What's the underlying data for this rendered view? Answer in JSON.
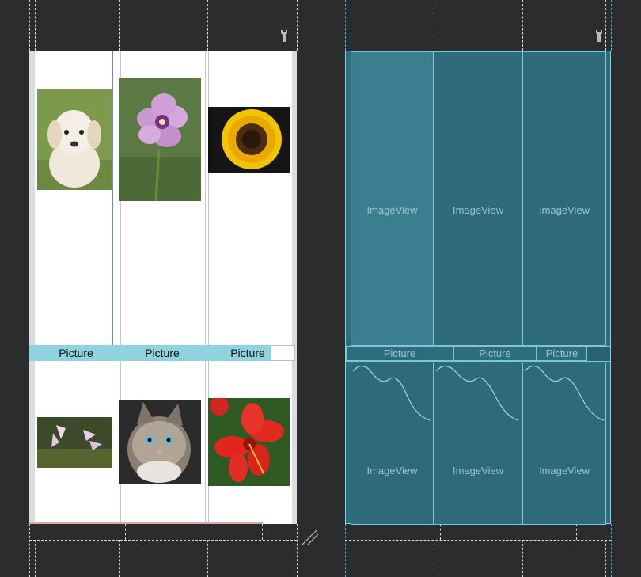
{
  "design": {
    "top_row": [
      {
        "icon": "puppy-photo",
        "label": "Picture"
      },
      {
        "icon": "flower-photo",
        "label": "Picture"
      },
      {
        "icon": "sunflower-photo",
        "label": "Picture"
      }
    ],
    "bottom_row": [
      {
        "icon": "lily-photo"
      },
      {
        "icon": "cat-photo"
      },
      {
        "icon": "hibiscus-photo"
      }
    ]
  },
  "blueprint": {
    "top_row": [
      {
        "label": "ImageView"
      },
      {
        "label": "ImageView"
      },
      {
        "label": "ImageView"
      }
    ],
    "pictures": [
      "Picture",
      "Picture",
      "Picture"
    ],
    "bottom_row": [
      {
        "label": "ImageView"
      },
      {
        "label": "ImageView"
      },
      {
        "label": "ImageView"
      }
    ]
  },
  "colors": {
    "background": "#2b2c2e",
    "caption_bar": "#8fd3df",
    "blueprint_fill": "#2f6d7e",
    "blueprint_stroke": "#76c9dc"
  }
}
